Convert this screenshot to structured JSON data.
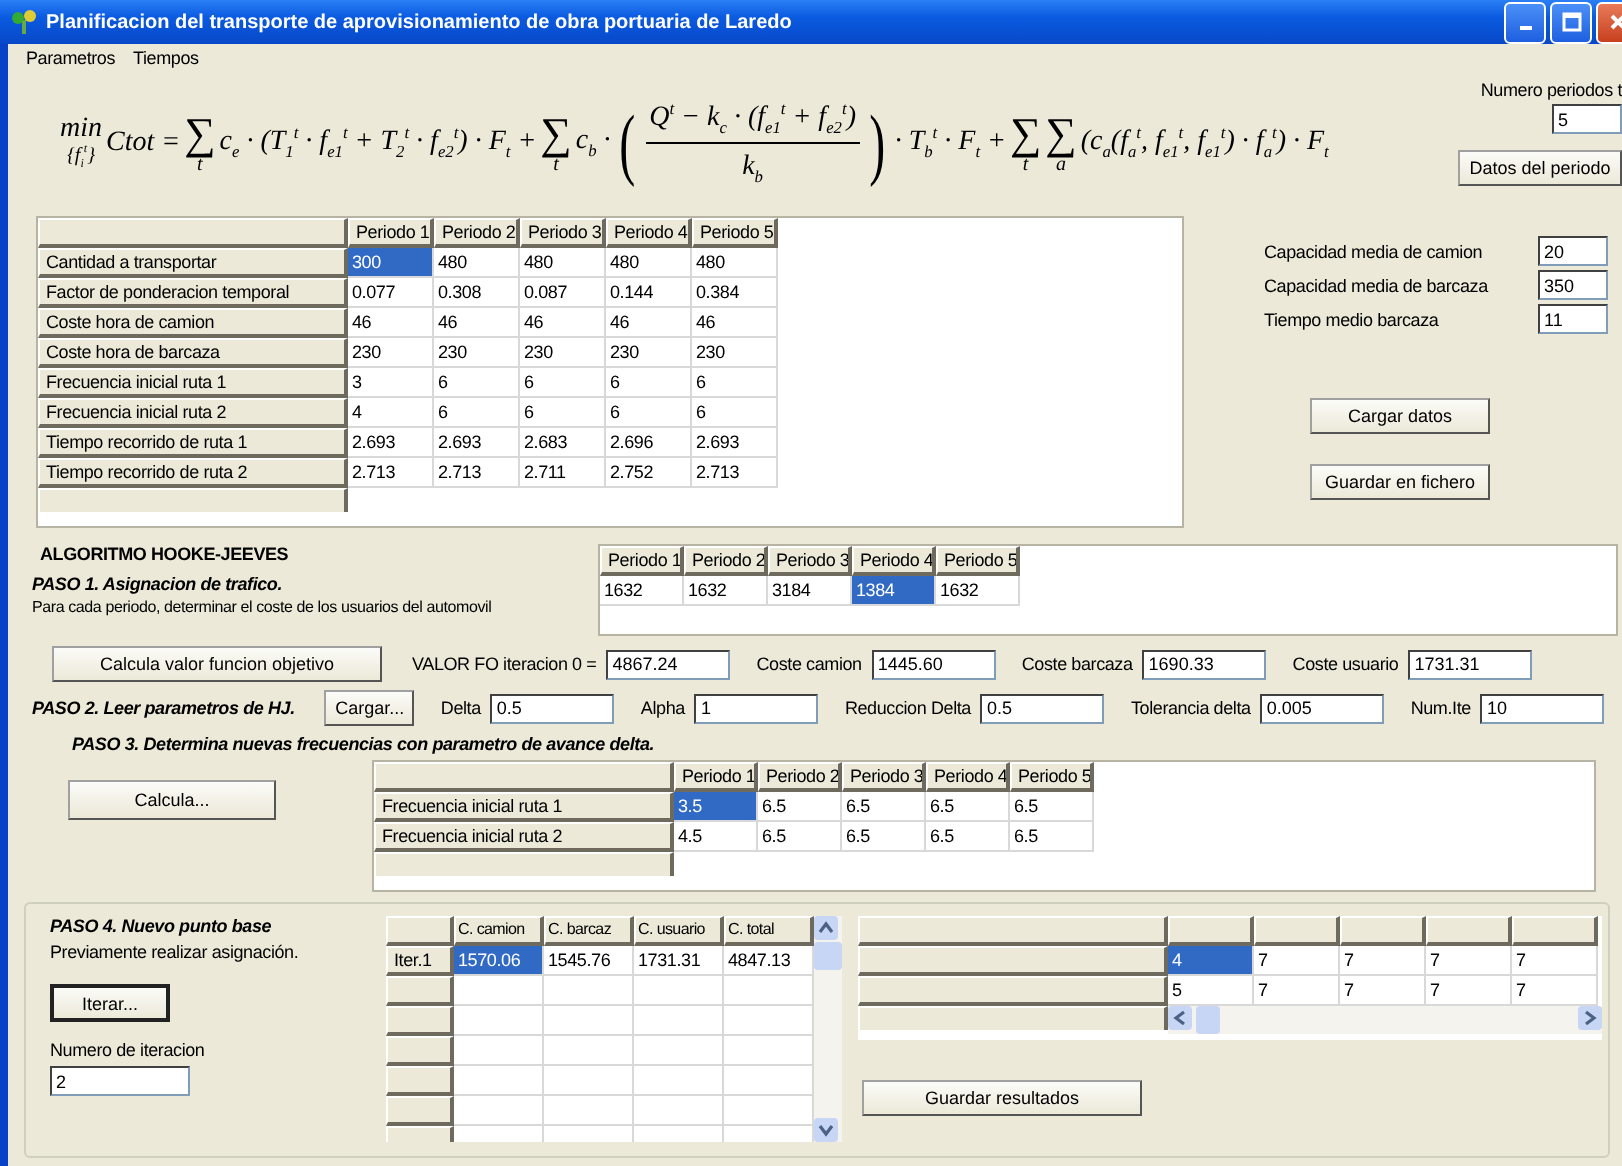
{
  "window": {
    "title": "Planificacion del transporte de aprovisionamiento de obra portuaria de Laredo"
  },
  "menu": [
    "Parametros",
    "Tiempos"
  ],
  "formula": [
    {
      "kind": "min",
      "text": "min",
      "below": "{f$_{i}$$^{t}$}"
    },
    {
      "kind": "text",
      "text": "Ctot ="
    },
    {
      "kind": "sum",
      "text": "∑",
      "below": "t"
    },
    {
      "kind": "text",
      "text": "c$_{e}$ · (T$_{1}$$^{t}$ · f$_{e1}$$^{t}$ + T$_{2}$$^{t}$ · f$_{e2}$$^{t}$) · F$_{t}$ +"
    },
    {
      "kind": "sum",
      "text": "∑",
      "below": "t"
    },
    {
      "kind": "text",
      "text": "c$_{b}$ ·"
    },
    {
      "kind": "frac",
      "open": "(",
      "numerator": "Q$^{t}$ − k$_{c}$ · (f$_{e1}$$^{t}$ + f$_{e2}$$^{t}$)",
      "denominator": "k$_{b}$",
      "close": ")"
    },
    {
      "kind": "text",
      "text": "· T$_{b}$$^{t}$ · F$_{t}$ +"
    },
    {
      "kind": "sum",
      "text": "∑",
      "below": "t"
    },
    {
      "kind": "sum",
      "text": "∑",
      "below": "a"
    },
    {
      "kind": "text",
      "text": "(c$_{a}$(f$_{a}$$^{t}$, f$_{e1}$$^{t}$, f$_{e1}$$^{t}$) · f$_{a}$$^{t}$) · F$_{t}$"
    }
  ],
  "periods": {
    "label": "Numero periodos t",
    "value": "5",
    "button": "Datos del periodo"
  },
  "data_table": {
    "columns": [
      "Periodo 1",
      "Periodo 2",
      "Periodo 3",
      "Periodo 4",
      "Periodo 5"
    ],
    "rows": [
      {
        "label": "Cantidad a transportar",
        "cells": [
          {
            "text": "300",
            "selected": true
          },
          {
            "text": "480",
            "selected": false
          },
          {
            "text": "480",
            "selected": false
          },
          {
            "text": "480",
            "selected": false
          },
          {
            "text": "480",
            "selected": false
          }
        ]
      },
      {
        "label": "Factor de ponderacion temporal",
        "cells": [
          {
            "text": "0.077",
            "selected": false
          },
          {
            "text": "0.308",
            "selected": false
          },
          {
            "text": "0.087",
            "selected": false
          },
          {
            "text": "0.144",
            "selected": false
          },
          {
            "text": "0.384",
            "selected": false
          }
        ]
      },
      {
        "label": "Coste hora de camion",
        "cells": [
          {
            "text": "46",
            "selected": false
          },
          {
            "text": "46",
            "selected": false
          },
          {
            "text": "46",
            "selected": false
          },
          {
            "text": "46",
            "selected": false
          },
          {
            "text": "46",
            "selected": false
          }
        ]
      },
      {
        "label": "Coste hora de barcaza",
        "cells": [
          {
            "text": "230",
            "selected": false
          },
          {
            "text": "230",
            "selected": false
          },
          {
            "text": "230",
            "selected": false
          },
          {
            "text": "230",
            "selected": false
          },
          {
            "text": "230",
            "selected": false
          }
        ]
      },
      {
        "label": "Frecuencia inicial ruta 1",
        "cells": [
          {
            "text": "3",
            "selected": false
          },
          {
            "text": "6",
            "selected": false
          },
          {
            "text": "6",
            "selected": false
          },
          {
            "text": "6",
            "selected": false
          },
          {
            "text": "6",
            "selected": false
          }
        ]
      },
      {
        "label": "Frecuencia inicial ruta 2",
        "cells": [
          {
            "text": "4",
            "selected": false
          },
          {
            "text": "6",
            "selected": false
          },
          {
            "text": "6",
            "selected": false
          },
          {
            "text": "6",
            "selected": false
          },
          {
            "text": "6",
            "selected": false
          }
        ]
      },
      {
        "label": "Tiempo recorrido de ruta 1",
        "cells": [
          {
            "text": "2.693",
            "selected": false
          },
          {
            "text": "2.693",
            "selected": false
          },
          {
            "text": "2.683",
            "selected": false
          },
          {
            "text": "2.696",
            "selected": false
          },
          {
            "text": "2.693",
            "selected": false
          }
        ]
      },
      {
        "label": "Tiempo recorrido de ruta 2",
        "cells": [
          {
            "text": "2.713",
            "selected": false
          },
          {
            "text": "2.713",
            "selected": false
          },
          {
            "text": "2.711",
            "selected": false
          },
          {
            "text": "2.752",
            "selected": false
          },
          {
            "text": "2.713",
            "selected": false
          }
        ]
      }
    ]
  },
  "parameters": [
    {
      "label": "Capacidad media de camion",
      "value": "20"
    },
    {
      "label": "Capacidad media de barcaza",
      "value": "350"
    },
    {
      "label": "Tiempo medio barcaza",
      "value": "11"
    }
  ],
  "side_buttons": [
    "Cargar datos",
    "Guardar en fichero"
  ],
  "algorithm": {
    "title": "ALGORITMO HOOKE-JEEVES",
    "step1": {
      "title": "PASO 1. Asignacion de trafico.",
      "description": "Para cada periodo, determinar el coste de los usuarios del automovil",
      "table": {
        "columns": [
          "Periodo 1",
          "Periodo 2",
          "Periodo 3",
          "Periodo 4",
          "Periodo 5"
        ],
        "rows": [
          {
            "cells": [
              {
                "text": "1632",
                "selected": false
              },
              {
                "text": "1632",
                "selected": false
              },
              {
                "text": "3184",
                "selected": false
              },
              {
                "text": "1384",
                "selected": true
              },
              {
                "text": "1632",
                "selected": false
              }
            ]
          }
        ]
      }
    },
    "objective": {
      "button": "Calcula valor funcion objetivo",
      "fields": [
        {
          "label": "VALOR FO iteracion 0 =",
          "value": "4867.24"
        },
        {
          "label": "Coste camion",
          "value": "1445.60"
        },
        {
          "label": "Coste barcaza",
          "value": "1690.33"
        },
        {
          "label": "Coste usuario",
          "value": "1731.31"
        }
      ]
    },
    "step2": {
      "title": "PASO 2. Leer parametros de HJ.",
      "button": "Cargar...",
      "fields": [
        {
          "label": "Delta",
          "value": "0.5"
        },
        {
          "label": "Alpha",
          "value": "1"
        },
        {
          "label": "Reduccion Delta",
          "value": "0.5"
        },
        {
          "label": "Tolerancia delta",
          "value": "0.005"
        },
        {
          "label": "Num.Ite",
          "value": "10"
        }
      ]
    },
    "step3": {
      "title": "PASO 3. Determina nuevas frecuencias con parametro de avance delta.",
      "button": "Calcula...",
      "table": {
        "columns": [
          "Periodo 1",
          "Periodo 2",
          "Periodo 3",
          "Periodo 4",
          "Periodo 5"
        ],
        "rows": [
          {
            "label": "Frecuencia inicial ruta 1",
            "cells": [
              {
                "text": "3.5",
                "selected": true
              },
              {
                "text": "6.5",
                "selected": false
              },
              {
                "text": "6.5",
                "selected": false
              },
              {
                "text": "6.5",
                "selected": false
              },
              {
                "text": "6.5",
                "selected": false
              }
            ]
          },
          {
            "label": "Frecuencia inicial ruta 2",
            "cells": [
              {
                "text": "4.5",
                "selected": false
              },
              {
                "text": "6.5",
                "selected": false
              },
              {
                "text": "6.5",
                "selected": false
              },
              {
                "text": "6.5",
                "selected": false
              },
              {
                "text": "6.5",
                "selected": false
              }
            ]
          }
        ]
      }
    },
    "step4": {
      "title": "PASO 4. Nuevo punto base",
      "description": "Previamente realizar asignación.",
      "button": {
        "label": "Iterar...",
        "focused": true
      },
      "iteration": {
        "label": "Numero de iteracion",
        "value": "2"
      },
      "table": {
        "columns": [
          "C. camion",
          "C. barcaz",
          "C. usuario",
          "C. total"
        ],
        "rows": [
          {
            "label": "Iter.1",
            "cells": [
              {
                "text": "1570.06",
                "selected": true
              },
              {
                "text": "1545.76",
                "selected": false
              },
              {
                "text": "1731.31",
                "selected": false
              },
              {
                "text": "4847.13",
                "selected": false
              }
            ]
          }
        ]
      },
      "result_table": {
        "rows": [
          {
            "cells": [
              {
                "text": "4",
                "selected": true
              },
              {
                "text": "7",
                "selected": false
              },
              {
                "text": "7",
                "selected": false
              },
              {
                "text": "7",
                "selected": false
              },
              {
                "text": "7",
                "selected": false
              }
            ]
          },
          {
            "cells": [
              {
                "text": "5",
                "selected": false
              },
              {
                "text": "7",
                "selected": false
              },
              {
                "text": "7",
                "selected": false
              },
              {
                "text": "7",
                "selected": false
              },
              {
                "text": "7",
                "selected": false
              }
            ]
          }
        ]
      },
      "save_button": "Guardar resultados"
    }
  }
}
